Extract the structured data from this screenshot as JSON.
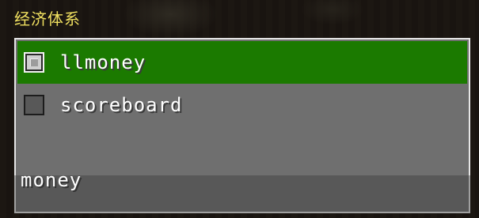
{
  "dialog": {
    "title": "经济体系"
  },
  "economy_selector": {
    "options": [
      {
        "label": "llmoney",
        "selected": true
      },
      {
        "label": "scoreboard",
        "selected": false
      }
    ]
  },
  "input": {
    "value": "money"
  },
  "colors": {
    "title": "#f0e060",
    "selected_row": "#1b7a00",
    "panel": "#6f6f6f",
    "panel_border": "#e6e6e6",
    "input_bg": "#585858"
  }
}
